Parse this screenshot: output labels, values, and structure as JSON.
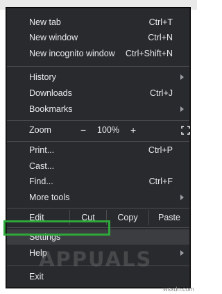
{
  "menu": {
    "new_tab": {
      "label": "New tab",
      "shortcut": "Ctrl+T"
    },
    "new_window": {
      "label": "New window",
      "shortcut": "Ctrl+N"
    },
    "new_incognito": {
      "label": "New incognito window",
      "shortcut": "Ctrl+Shift+N"
    },
    "history": {
      "label": "History"
    },
    "downloads": {
      "label": "Downloads",
      "shortcut": "Ctrl+J"
    },
    "bookmarks": {
      "label": "Bookmarks"
    },
    "zoom": {
      "label": "Zoom",
      "minus": "−",
      "value": "100%",
      "plus": "+"
    },
    "print": {
      "label": "Print...",
      "shortcut": "Ctrl+P"
    },
    "cast": {
      "label": "Cast..."
    },
    "find": {
      "label": "Find...",
      "shortcut": "Ctrl+F"
    },
    "more_tools": {
      "label": "More tools"
    },
    "edit": {
      "label": "Edit",
      "cut": "Cut",
      "copy": "Copy",
      "paste": "Paste"
    },
    "settings": {
      "label": "Settings"
    },
    "help": {
      "label": "Help"
    },
    "exit": {
      "label": "Exit"
    }
  },
  "watermark": "APPUALS",
  "site": "wsxdn.com",
  "colors": {
    "menu_bg": "#292a2d",
    "highlight": "#2ea83a"
  }
}
